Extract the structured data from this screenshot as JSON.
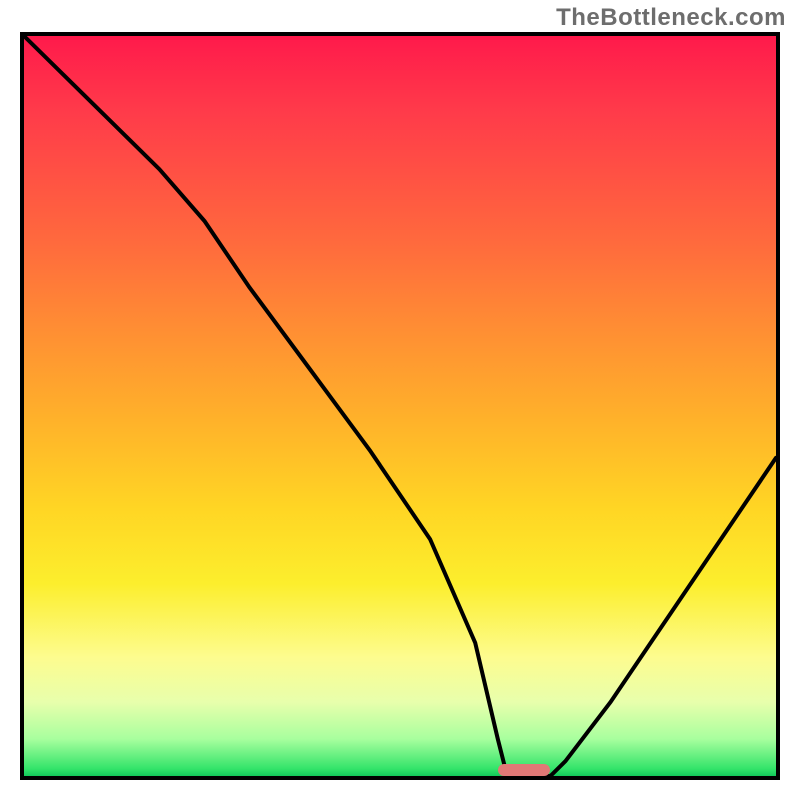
{
  "branding": {
    "watermark": "TheBottleneck.com"
  },
  "colors": {
    "curve": "#000000",
    "border": "#000000",
    "marker": "#e17876",
    "gradient_top": "#ff1a4b",
    "gradient_bottom": "#12c85a"
  },
  "chart_data": {
    "type": "line",
    "title": "",
    "xlabel": "",
    "ylabel": "",
    "xlim": [
      0,
      100
    ],
    "ylim": [
      0,
      100
    ],
    "grid": false,
    "legend": false,
    "annotations": [
      {
        "name": "optimum-marker",
        "x_range": [
          63,
          70
        ],
        "y": 0
      }
    ],
    "series": [
      {
        "name": "bottleneck-curve",
        "x": [
          0,
          8,
          18,
          24,
          30,
          38,
          46,
          54,
          60,
          63,
          64,
          68,
          70,
          72,
          78,
          86,
          94,
          100
        ],
        "y": [
          100,
          92,
          82,
          75,
          66,
          55,
          44,
          32,
          18,
          5,
          1,
          0,
          0,
          2,
          10,
          22,
          34,
          43
        ]
      }
    ]
  }
}
